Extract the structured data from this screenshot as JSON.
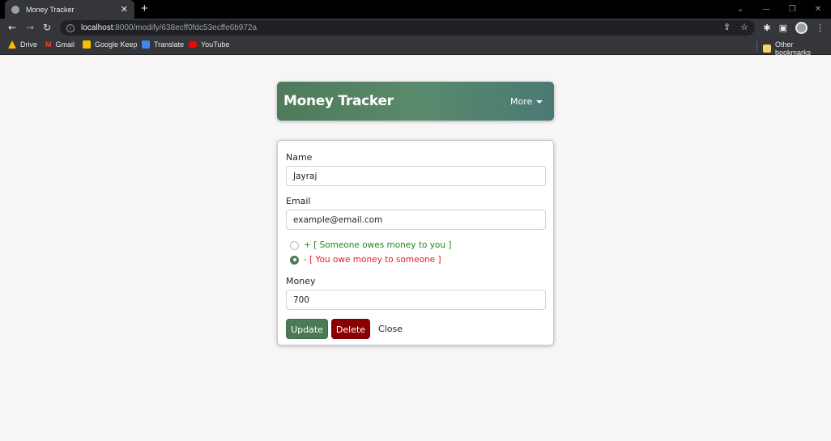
{
  "browser": {
    "tab_title": "Money Tracker",
    "url_host": "localhost",
    "url_path": ":8000/modify/638ecff0fdc53ecffe6b972a",
    "bookmarks": [
      {
        "label": "Drive",
        "color": "#fbbc04"
      },
      {
        "label": "Gmail",
        "color": "#ea4335"
      },
      {
        "label": "Google Keep",
        "color": "#fbbc04"
      },
      {
        "label": "Translate",
        "color": "#4285f4"
      },
      {
        "label": "YouTube",
        "color": "#ff0000"
      }
    ],
    "other_bookmarks": "Other bookmarks"
  },
  "app": {
    "title": "Money Tracker",
    "more_label": "More"
  },
  "form": {
    "name_label": "Name",
    "name_value": "Jayraj",
    "email_label": "Email",
    "email_value": "example@email.com",
    "radio_owes_you": "+ [ Someone owes money to you ]",
    "radio_you_owe": "- [ You owe money to someone ]",
    "selected": "you_owe",
    "money_label": "Money",
    "money_value": "700",
    "update_label": "Update",
    "delete_label": "Delete",
    "close_label": "Close"
  },
  "colors": {
    "accent": "#4b7a55",
    "danger": "#8b0000"
  }
}
